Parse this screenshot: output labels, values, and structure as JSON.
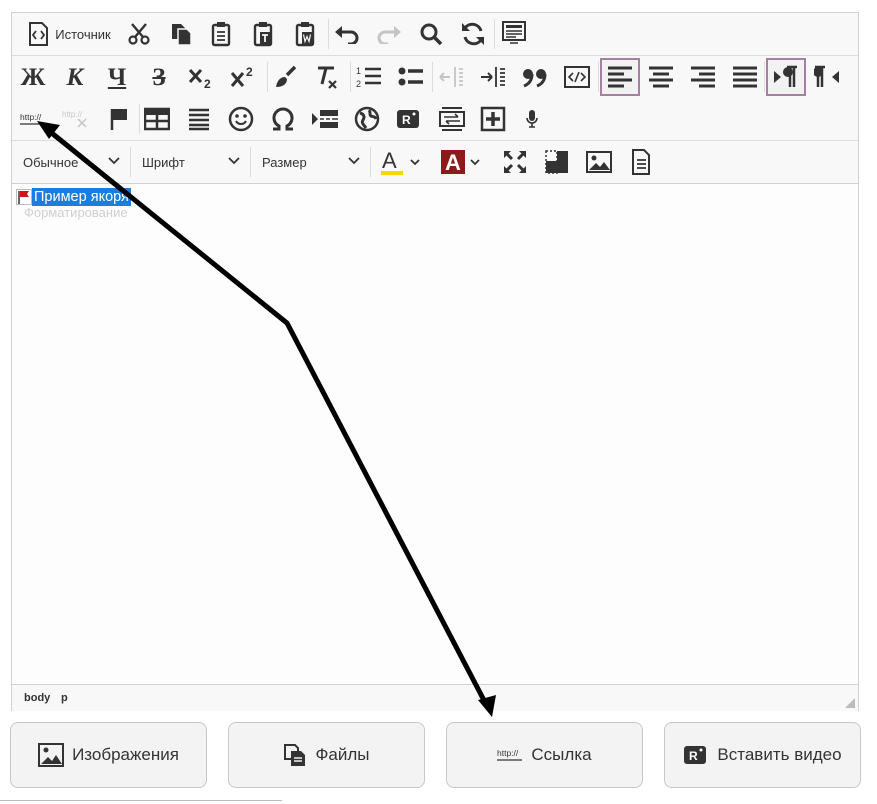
{
  "toolbar": {
    "source_label": "Источник",
    "bold_glyph": "Ж",
    "italic_glyph": "К",
    "underline_glyph": "Ч",
    "strike_glyph": "З",
    "format_combo": "Обычное",
    "font_combo": "Шрифт",
    "size_combo": "Размер",
    "link_glyph": "http://",
    "unlink_glyph": "http://",
    "text_color_glyph": "A",
    "bg_color_glyph": "A",
    "rtl_glyph": "R",
    "text_color": "#f5d800",
    "bg_color": "#8b1a1a",
    "active_border": "#a680a0"
  },
  "content": {
    "anchor_text": "Пример якоря",
    "ghost_text": "Форматирование"
  },
  "statusbar": {
    "path": [
      "body",
      "p"
    ]
  },
  "buttons": [
    {
      "label": "Изображения",
      "icon": "image-icon"
    },
    {
      "label": "Файлы",
      "icon": "files-icon"
    },
    {
      "label": "Ссылка",
      "icon": "link-icon",
      "icon_text": "http://"
    },
    {
      "label": "Вставить видео",
      "icon": "video-icon",
      "icon_text": "R"
    }
  ]
}
